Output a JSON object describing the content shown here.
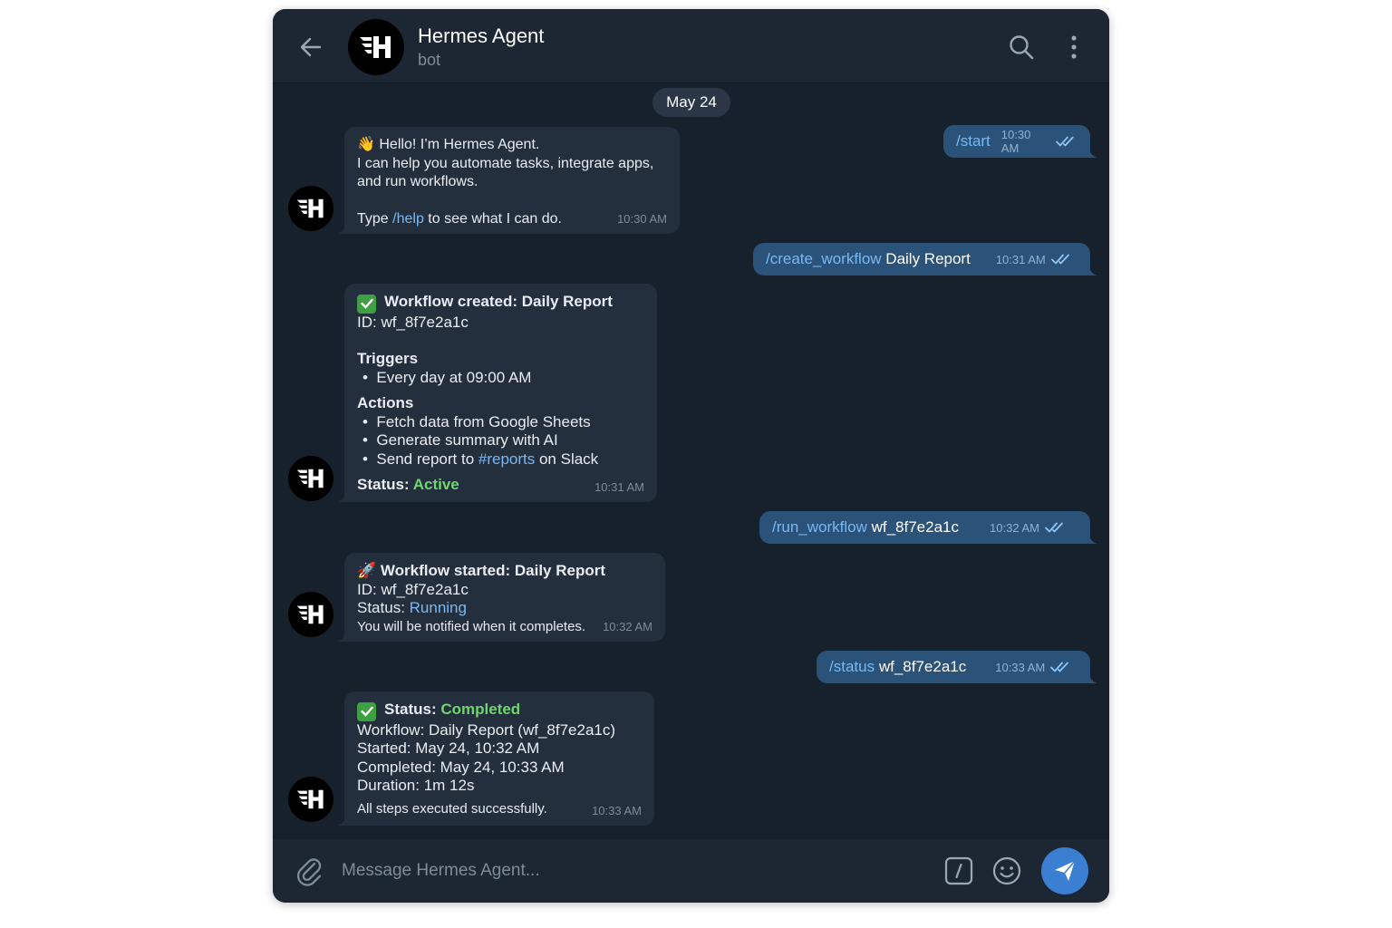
{
  "header": {
    "title": "Hermes Agent",
    "subtitle": "bot",
    "icons": {
      "back": "arrow-left-icon",
      "search": "search-icon",
      "more": "more-vertical-icon"
    }
  },
  "date_chip": "May 24",
  "messages": {
    "out_start": {
      "command": "/start",
      "time": "10:30 AM"
    },
    "in_hello": {
      "line1": "Hello! I’m Hermes Agent.",
      "line2": "I can help you automate tasks, integrate apps,",
      "line3": "and run workflows.",
      "type_prefix": "Type ",
      "help_cmd": "/help",
      "type_suffix": " to see what I can do.",
      "time": "10:30 AM"
    },
    "out_create": {
      "command": "/create_workflow",
      "arg": " Daily Report",
      "time": "10:31 AM"
    },
    "in_created": {
      "heading": "Workflow created: Daily Report",
      "id_label": "ID: ",
      "id_value": "wf_8f7e2a1c",
      "triggers_title": "Triggers",
      "triggers": [
        "Every day at 09:00 AM"
      ],
      "actions_title": "Actions",
      "action1": "Fetch data from Google Sheets",
      "action2": "Generate summary with AI",
      "action3_prefix": "Send report to ",
      "action3_channel": "#reports",
      "action3_suffix": " on Slack",
      "status_label": "Status: ",
      "status_value": "Active",
      "time": "10:31 AM"
    },
    "out_run": {
      "command": "/run_workflow",
      "arg": " wf_8f7e2a1c",
      "time": "10:32 AM"
    },
    "in_started": {
      "heading": "Workflow started: Daily Report",
      "id_line": "ID: wf_8f7e2a1c",
      "status_label": "Status: ",
      "status_value": "Running",
      "note": "You will be notified when it completes.",
      "time": "10:32 AM"
    },
    "out_status": {
      "command": "/status",
      "arg": " wf_8f7e2a1c",
      "time": "10:33 AM"
    },
    "in_completed": {
      "status_label": "Status: ",
      "status_value": "Completed",
      "workflow": "Workflow: Daily Report (wf_8f7e2a1c)",
      "started": "Started: May 24, 10:32 AM",
      "completed": "Completed: May 24, 10:33 AM",
      "duration": "Duration: 1m 12s",
      "result": "All steps executed successfully.",
      "time": "10:33 AM"
    }
  },
  "composer": {
    "placeholder": "Message Hermes Agent...",
    "icons": {
      "attach": "paperclip-icon",
      "commands": "slash-command-icon",
      "emoji": "emoji-icon",
      "send": "send-icon"
    }
  },
  "colors": {
    "background": "#17212b",
    "header": "#1c2733",
    "bubble_in": "#242f3d",
    "bubble_out": "#2b5278",
    "accent": "#79b8f3",
    "success": "#6fd66f",
    "send_button": "#3a7fd1"
  }
}
